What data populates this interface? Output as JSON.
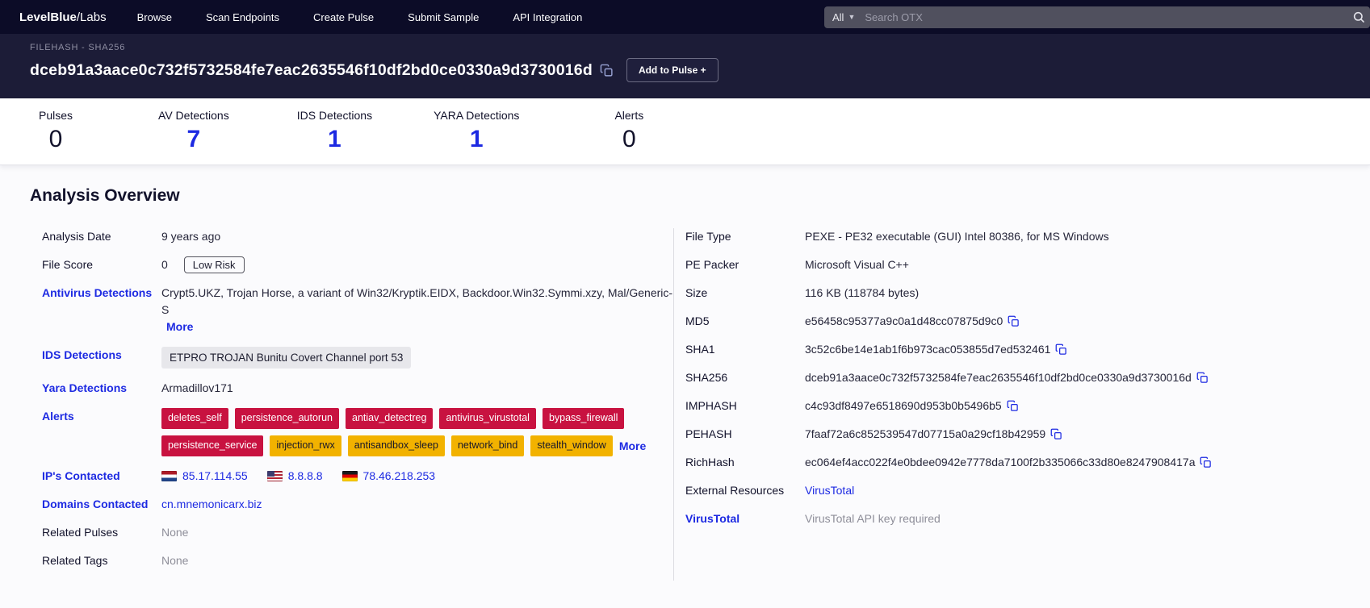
{
  "palette": {
    "accent_blue": "#1d2ae2",
    "badge_red": "#c81240",
    "badge_yellow": "#f2b200",
    "navbar_bg": "#0c0c27",
    "header_bg": "#1c1c37"
  },
  "navbar": {
    "logo_prefix": "LevelBlue",
    "logo_suffix": "/Labs",
    "items": [
      {
        "label": "Browse"
      },
      {
        "label": "Scan Endpoints"
      },
      {
        "label": "Create Pulse"
      },
      {
        "label": "Submit Sample"
      },
      {
        "label": "API Integration"
      }
    ],
    "search": {
      "filter_label": "All",
      "placeholder": "Search OTX"
    }
  },
  "header": {
    "type_label": "FILEHASH - SHA256",
    "hash": "dceb91a3aace0c732f5732584fe7eac2635546f10df2bd0ce0330a9d3730016d",
    "add_to_pulse_label": "Add to Pulse +"
  },
  "stats": {
    "items": [
      {
        "label": "Pulses",
        "value": "0",
        "color": "dark"
      },
      {
        "label": "AV Detections",
        "value": "7",
        "color": "blue"
      },
      {
        "label": "IDS Detections",
        "value": "1",
        "color": "blue"
      },
      {
        "label": "YARA Detections",
        "value": "1",
        "color": "blue"
      },
      {
        "label": "Alerts",
        "value": "0",
        "color": "dark"
      }
    ]
  },
  "analysis": {
    "title": "Analysis Overview",
    "left": {
      "analysis_date": {
        "label": "Analysis Date",
        "value": "9 years ago"
      },
      "file_score": {
        "label": "File Score",
        "value": "0",
        "badge": "Low Risk"
      },
      "antivirus": {
        "label": "Antivirus Detections",
        "value": "Crypt5.UKZ,  Trojan Horse,  a variant of Win32/Kryptik.EIDX,  Backdoor.Win32.Symmi.xzy,  Mal/Generic-S",
        "more_label": "More"
      },
      "ids": {
        "label": "IDS Detections",
        "badge": "ETPRO TROJAN Bunitu Covert Channel port 53"
      },
      "yara": {
        "label": "Yara Detections",
        "value": "Armadillov171"
      },
      "alerts": {
        "label": "Alerts",
        "badges": [
          {
            "text": "deletes_self",
            "severity": "high"
          },
          {
            "text": "persistence_autorun",
            "severity": "high"
          },
          {
            "text": "antiav_detectreg",
            "severity": "high"
          },
          {
            "text": "antivirus_virustotal",
            "severity": "high"
          },
          {
            "text": "bypass_firewall",
            "severity": "high"
          },
          {
            "text": "persistence_service",
            "severity": "high"
          },
          {
            "text": "injection_rwx",
            "severity": "medium"
          },
          {
            "text": "antisandbox_sleep",
            "severity": "medium"
          },
          {
            "text": "network_bind",
            "severity": "medium"
          },
          {
            "text": "stealth_window",
            "severity": "medium"
          }
        ],
        "more_label": "More"
      },
      "ips": {
        "label": "IP's Contacted",
        "items": [
          {
            "ip": "85.17.114.55",
            "country": "nl"
          },
          {
            "ip": "8.8.8.8",
            "country": "us"
          },
          {
            "ip": "78.46.218.253",
            "country": "de"
          }
        ]
      },
      "domains": {
        "label": "Domains Contacted",
        "value": "cn.mnemonicarx.biz"
      },
      "related_pulses": {
        "label": "Related Pulses",
        "value": "None"
      },
      "related_tags": {
        "label": "Related Tags",
        "value": "None"
      }
    },
    "right": {
      "file_type": {
        "label": "File Type",
        "value": "PEXE - PE32 executable (GUI) Intel 80386, for MS Windows"
      },
      "pe_packer": {
        "label": "PE Packer",
        "value": "Microsoft Visual C++"
      },
      "size": {
        "label": "Size",
        "value": "116 KB (118784 bytes)"
      },
      "md5": {
        "label": "MD5",
        "value": "e56458c95377a9c0a1d48cc07875d9c0"
      },
      "sha1": {
        "label": "SHA1",
        "value": "3c52c6be14e1ab1f6b973cac053855d7ed532461"
      },
      "sha256": {
        "label": "SHA256",
        "value": "dceb91a3aace0c732f5732584fe7eac2635546f10df2bd0ce0330a9d3730016d"
      },
      "imphash": {
        "label": "IMPHASH",
        "value": "c4c93df8497e6518690d953b0b5496b5"
      },
      "pehash": {
        "label": "PEHASH",
        "value": "7faaf72a6c852539547d07715a0a29cf18b42959"
      },
      "richhash": {
        "label": "RichHash",
        "value": "ec064ef4acc022f4e0bdee0942e7778da7100f2b335066c33d80e8247908417a"
      },
      "external_resources": {
        "label": "External Resources",
        "link_label": "VirusTotal"
      },
      "virustotal": {
        "label": "VirusTotal",
        "value": "VirusTotal API key required"
      }
    }
  }
}
